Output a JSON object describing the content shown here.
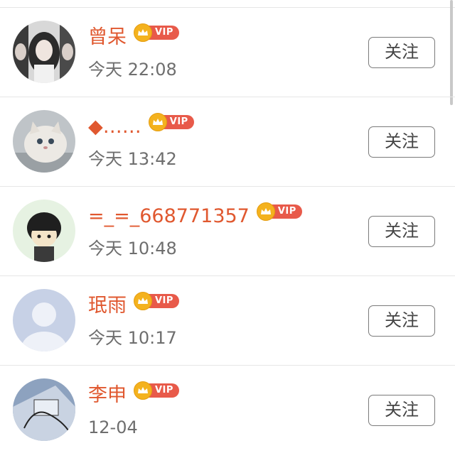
{
  "follow_list": {
    "vip_label": "VIP",
    "follow_label": "关注",
    "users": [
      {
        "name": "曾呆",
        "time": "今天 22:08",
        "avatar": "girl-photo"
      },
      {
        "name": "◆……",
        "time": "今天 13:42",
        "avatar": "kitten-photo"
      },
      {
        "name": "=_=_668771357",
        "time": "今天 10:48",
        "avatar": "cartoon-child"
      },
      {
        "name": "珉雨",
        "time": "今天 10:17",
        "avatar": "default-avatar"
      },
      {
        "name": "李申",
        "time": "12-04",
        "avatar": "earphones-photo"
      }
    ]
  },
  "colors": {
    "name": "#e0582f",
    "vip_badge": "#e85a4a",
    "crown": "#f4b21e",
    "time": "#6e6e6e",
    "divider": "#e6e6e6"
  }
}
